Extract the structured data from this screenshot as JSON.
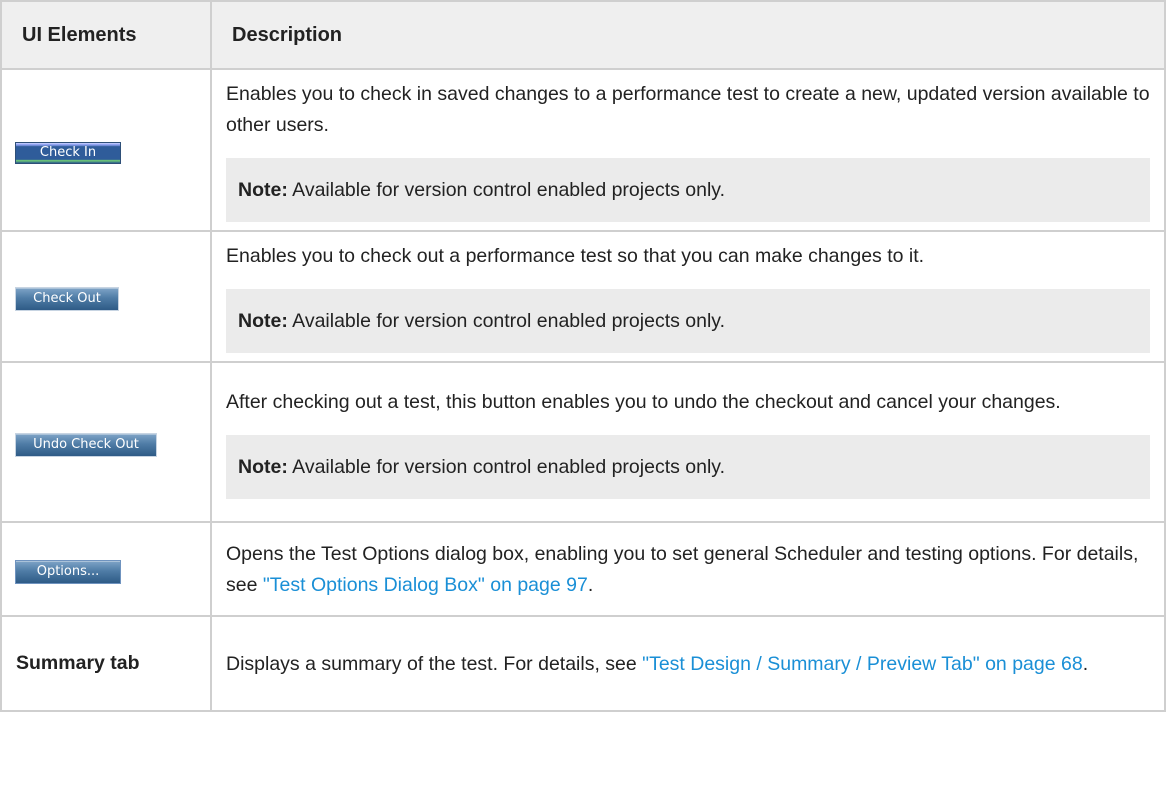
{
  "table": {
    "headers": {
      "elements": "UI Elements",
      "description": "Description"
    },
    "rows": [
      {
        "button_label": "Check In",
        "description": "Enables you to check in saved changes to a performance test to create a new, updated version available to other users.",
        "note_label": "Note:",
        "note_text": " Available for version control enabled projects only."
      },
      {
        "button_label": "Check Out",
        "description": "Enables you to check out a performance test so that you can make changes to it.",
        "note_label": "Note:",
        "note_text": " Available for version control enabled projects only."
      },
      {
        "button_label": "Undo Check Out",
        "description": "After checking out a test, this button enables you to undo the checkout and cancel your changes.",
        "note_label": "Note:",
        "note_text": " Available for version control enabled projects only."
      },
      {
        "button_label": "Options...",
        "description_prefix": "Opens the Test Options dialog box, enabling you to set general Scheduler and testing options. For details, see ",
        "link": "\"Test Options Dialog Box\" on page 97",
        "description_suffix": "."
      },
      {
        "element_label": "Summary tab",
        "description_prefix": "Displays a summary of the test. For details, see ",
        "link": "\"Test Design / Summary / Preview Tab\" on page 68",
        "description_suffix": "."
      }
    ]
  },
  "colors": {
    "link": "#1a8fd6",
    "header_bg": "#efefef",
    "note_bg": "#ebebeb",
    "border": "#cfcfcf"
  }
}
